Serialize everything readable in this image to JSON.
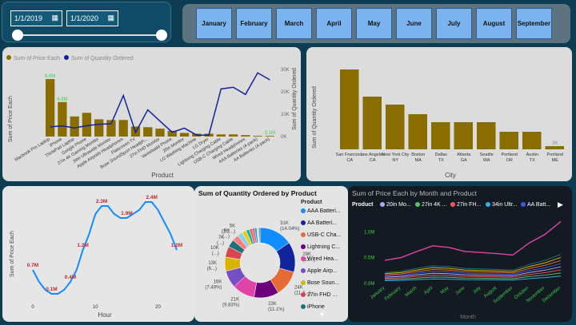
{
  "slicer": {
    "start_date": "1/1/2019",
    "end_date": "1/1/2020"
  },
  "months": [
    "January",
    "February",
    "March",
    "April",
    "May",
    "June",
    "July",
    "August",
    "September"
  ],
  "product_chart": {
    "legend": [
      "Sum of Price Each",
      "Sum of Quantity Ordered"
    ],
    "xlabel": "Product",
    "ylabel_left": "Sum of Price Each",
    "ylabel_right": "Sum of Quantity Ordered",
    "right_ticks": [
      "30K",
      "20K",
      "10K",
      "0K"
    ],
    "categories": [
      "Macbook Pro Laptop",
      "iPhone",
      "ThinkPad Laptop",
      "Google Phone",
      "27in 4K Gaming Monitor",
      "34in Ultrawide Monitor",
      "Apple Airpods Headphones",
      "Flatscreen TV",
      "Bose SoundSport Headph...",
      "27in FHD Monitor",
      "Vareebadd Phone",
      "20in Monitor",
      "LG Washing Machine",
      "LG Dryer",
      "Lightning Charging Cable",
      "USB-C Charging Cable",
      "Wired Headphones",
      "AAA Batteries (4-pack)",
      "AA Batteries (4-pack)"
    ],
    "labels": [
      "8.0M",
      "4.8M",
      "",
      "",
      "",
      "",
      "",
      "",
      "",
      "",
      "",
      "",
      "",
      "",
      "",
      "",
      "",
      "",
      "0.1M"
    ],
    "bars": [
      8.0,
      4.8,
      2.8,
      3.3,
      2.4,
      2.3,
      2.3,
      1.4,
      1.3,
      1.1,
      0.8,
      0.5,
      0.4,
      0.4,
      0.3,
      0.3,
      0.2,
      0.1,
      0.1
    ],
    "line": [
      4.7,
      5.2,
      4.2,
      5.3,
      6.0,
      6.2,
      20.0,
      2.0,
      13.0,
      7.5,
      2.1,
      4.1,
      0.7,
      0.7,
      23.2,
      24.0,
      20.5,
      31.0,
      27.6
    ]
  },
  "city_chart": {
    "xlabel": "City",
    "ylabel": "Sum of Quantity Ordered",
    "categories": [
      "San Francisco CA",
      "Los Angeles CA",
      "New York City NY",
      "Boston MA",
      "Dallas TX",
      "Atlanta GA",
      "Seattle WA",
      "Portland OR",
      "Austin TX",
      "Portland ME"
    ],
    "labels": [
      "",
      "",
      "",
      "",
      "",
      "",
      "",
      "",
      "",
      "2K"
    ],
    "values": [
      50,
      33,
      28,
      22,
      17,
      17,
      17,
      11,
      11,
      2
    ]
  },
  "hour_chart": {
    "xlabel": "Hour",
    "ylabel": "Sum of Price Each",
    "x_ticks": [
      "0",
      "10",
      "20"
    ],
    "x": [
      0,
      1,
      2,
      3,
      4,
      5,
      6,
      7,
      8,
      9,
      10,
      11,
      12,
      13,
      14,
      15,
      16,
      17,
      18,
      19,
      20,
      21,
      22,
      23
    ],
    "values": [
      0.7,
      0.4,
      0.2,
      0.1,
      0.1,
      0.2,
      0.4,
      0.7,
      1.2,
      1.6,
      2.1,
      2.3,
      2.3,
      2.1,
      2.0,
      2.0,
      2.1,
      2.2,
      2.4,
      2.4,
      2.2,
      1.9,
      1.6,
      1.2
    ],
    "data_labels": [
      {
        "x": 0,
        "text": "0.7M"
      },
      {
        "x": 3,
        "text": "0.1M"
      },
      {
        "x": 6,
        "text": "0.4M"
      },
      {
        "x": 8,
        "text": "1.2M"
      },
      {
        "x": 11,
        "text": "2.3M"
      },
      {
        "x": 15,
        "text": "1.9M"
      },
      {
        "x": 19,
        "text": "2.4M"
      },
      {
        "x": 23,
        "text": "1.2M"
      }
    ]
  },
  "donut_chart": {
    "title": "Sum of Quantity Ordered by Product",
    "legend_title": "Product",
    "legend": [
      "AAA Batteri...",
      "AA Batteri...",
      "USB-C Cha...",
      "Lightning C...",
      "Wired Hea...",
      "Apple Airp...",
      "Bose Soun...",
      "27in FHD ...",
      "iPhone"
    ],
    "colors": [
      "#118dff",
      "#12239e",
      "#e66c37",
      "#6b007b",
      "#e044a7",
      "#744ec2",
      "#d9b300",
      "#d64550",
      "#197278"
    ],
    "slices": [
      {
        "label": "31K (14.04%)",
        "value": 31
      },
      {
        "label": "28K (13...)",
        "value": 28
      },
      {
        "label": "24K (11.4...)",
        "value": 24
      },
      {
        "label": "23K (11.1%)",
        "value": 23
      },
      {
        "label": "21K (9.83%)",
        "value": 21
      },
      {
        "label": "16K (7.49%)",
        "value": 16
      },
      {
        "label": "13K (6...)",
        "value": 13
      },
      {
        "label": "10K (...)",
        "value": 10
      },
      {
        "label": "7K (...)",
        "value": 7
      },
      {
        "label": "6K (...)",
        "value": 6
      },
      {
        "label": "5K (2.2...)",
        "value": 5
      },
      {
        "label": "",
        "value": 4
      },
      {
        "label": "",
        "value": 3
      },
      {
        "label": "",
        "value": 3
      },
      {
        "label": "",
        "value": 2
      },
      {
        "label": "",
        "value": 2
      },
      {
        "label": "",
        "value": 1
      },
      {
        "label": "",
        "value": 1
      },
      {
        "label": "",
        "value": 1
      }
    ]
  },
  "month_chart": {
    "title": "Sum of Price Each by Month and Product",
    "legend_title": "Product",
    "legend": [
      "20in Mo...",
      "27in 4K ...",
      "27in FH...",
      "34in Ultr...",
      "AA Batt..."
    ],
    "legend_colors": [
      "#b4a7f7",
      "#5ec26b",
      "#f2545b",
      "#2fb0ec",
      "#3b5bdb"
    ],
    "y_ticks": [
      "1.0M",
      "0.5M",
      "0.0M"
    ],
    "xlabel": "Month",
    "categories": [
      "January",
      "February",
      "March",
      "April",
      "May",
      "June",
      "July",
      "August",
      "September",
      "October",
      "November",
      "December"
    ],
    "top_series": [
      0.45,
      0.5,
      0.62,
      0.73,
      0.7,
      0.62,
      0.6,
      0.58,
      0.55,
      0.78,
      0.95,
      1.2
    ]
  }
}
